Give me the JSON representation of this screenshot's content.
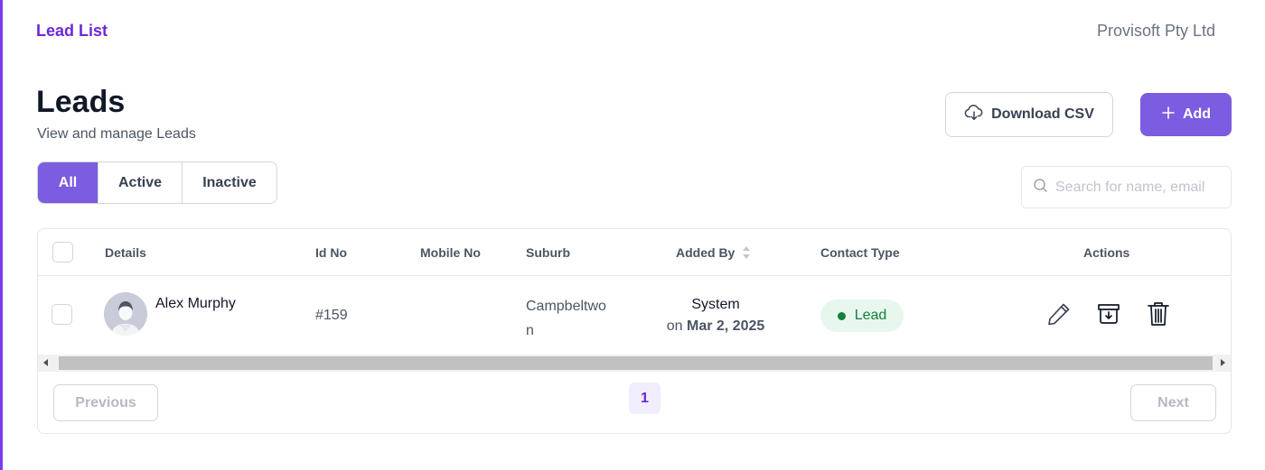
{
  "header": {
    "breadcrumb": "Lead List",
    "company": "Provisoft Pty Ltd"
  },
  "page": {
    "title": "Leads",
    "subtitle": "View and manage Leads"
  },
  "actions": {
    "download_label": "Download CSV",
    "add_label": "Add"
  },
  "filters": {
    "tabs": [
      {
        "label": "All",
        "active": true
      },
      {
        "label": "Active",
        "active": false
      },
      {
        "label": "Inactive",
        "active": false
      }
    ]
  },
  "search": {
    "placeholder": "Search for name, email",
    "value": ""
  },
  "table": {
    "columns": [
      "Details",
      "Id No",
      "Mobile No",
      "Suburb",
      "Added By",
      "Contact Type",
      "Actions"
    ],
    "rows": [
      {
        "name": "Alex Murphy",
        "id_no": "#159",
        "mobile_no": "",
        "suburb_line1": "Campbeltwo",
        "suburb_line2": "n",
        "added_by": "System",
        "added_on_prefix": "on",
        "added_on_date": "Mar 2, 2025",
        "contact_type": "Lead"
      }
    ]
  },
  "pagination": {
    "previous_label": "Previous",
    "current_page": "1",
    "next_label": "Next"
  },
  "icons": {
    "download": "cloud-download-icon",
    "add": "plus-icon",
    "search": "search-icon",
    "sort": "sort-icon",
    "avatar": "user-avatar-icon",
    "edit": "pencil-icon",
    "archive": "archive-icon",
    "delete": "trash-icon"
  },
  "colors": {
    "accent": "#7c5ce0",
    "breadcrumb": "#6d28d9",
    "badge_bg": "#e7f7ee",
    "badge_text": "#15803d"
  }
}
